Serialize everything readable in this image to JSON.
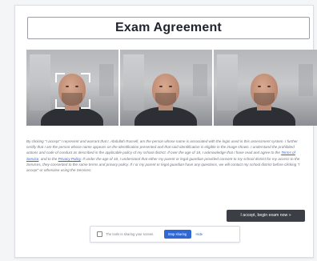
{
  "header": {
    "title": "Exam Agreement"
  },
  "agreement": {
    "text_before_terms": "By clicking \"I accept\" I represent and warrant that I, Abdullah Russell, am the person whose name is associated with the login used in this assessment system. I further certify that I am the person whose name appears on the identification presented and that said identification is eligible in the image shown. I understand the prohibited actions and code of conduct as described in the applicable policy of my school district. If over the age of 18, I acknowledge that I have read and agree to the ",
    "terms_link": "Terms of Service",
    "text_between_links": ", and to the ",
    "privacy_link": "Privacy Policy",
    "text_after_privacy": ". If under the age of 18, I understand that either my parent or legal guardian provided consent to my school district for my access to the Services, they consented to the same terms and privacy policy. If I or my parent or legal guardian have any questions, we will contact my school district before clicking \"I accept\" or otherwise using the Services."
  },
  "actions": {
    "accept_label": "I accept, begin exam now »"
  },
  "share_bar": {
    "status_text": "The tools is sharing your screen.",
    "stop_label": "Stop sharing",
    "hide_label": "Hide"
  },
  "icons": {
    "face_frame": "face-frame-icon",
    "screen_share": "screen-share-icon"
  },
  "colors": {
    "accent": "#2f67d5",
    "button_dark": "#3b3e45",
    "link": "#3567d6"
  }
}
